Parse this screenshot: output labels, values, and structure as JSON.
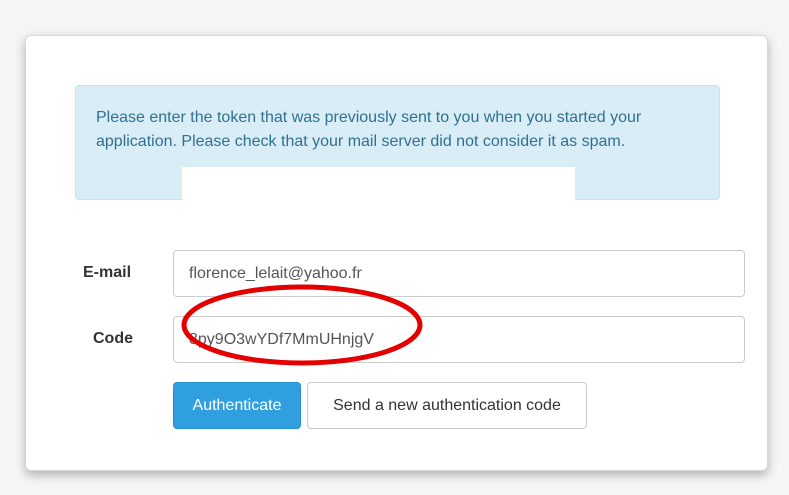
{
  "alert": {
    "message": "Please enter the token that was previously sent to you when you started your application. Please check that your mail server did not consider it as spam."
  },
  "form": {
    "email_label": "E-mail",
    "email_value": "florence_lelait@yahoo.fr",
    "code_label": "Code",
    "code_value": "8py9O3wYDf7MmUHnjgV"
  },
  "buttons": {
    "authenticate_label": "Authenticate",
    "resend_label": "Send a new authentication code"
  },
  "colors": {
    "alert_bg": "#d9edf7",
    "alert_text": "#31708f",
    "primary": "#2f9fe0",
    "highlight_ring": "#e30000"
  }
}
